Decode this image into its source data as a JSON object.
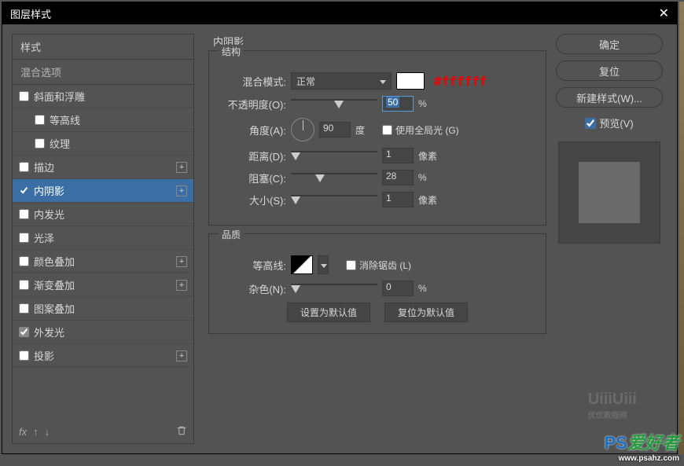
{
  "title": "图层样式",
  "styles_header": "样式",
  "blend_options": "混合选项",
  "style_items": [
    {
      "label": "斜面和浮雕",
      "checked": false,
      "plus": false
    },
    {
      "label": "等高线",
      "checked": false,
      "child": true
    },
    {
      "label": "纹理",
      "checked": false,
      "child": true
    },
    {
      "label": "描边",
      "checked": false,
      "plus": true
    },
    {
      "label": "内阴影",
      "checked": true,
      "plus": true,
      "selected": true
    },
    {
      "label": "内发光",
      "checked": false
    },
    {
      "label": "光泽",
      "checked": false
    },
    {
      "label": "颜色叠加",
      "checked": false,
      "plus": true
    },
    {
      "label": "渐变叠加",
      "checked": false,
      "plus": true
    },
    {
      "label": "图案叠加",
      "checked": false
    },
    {
      "label": "外发光",
      "checked": true
    },
    {
      "label": "投影",
      "checked": false,
      "plus": true
    }
  ],
  "fx_label": "fx",
  "mid": {
    "heading": "内阴影",
    "structure": "结构",
    "blend_mode_label": "混合模式:",
    "blend_mode_value": "正常",
    "hex": "#ffffff",
    "opacity_label": "不透明度(O):",
    "opacity_value": "50",
    "percent": "%",
    "angle_label": "角度(A):",
    "angle_value": "90",
    "degree": "度",
    "global_light": "使用全局光 (G)",
    "distance_label": "距离(D):",
    "distance_value": "1",
    "px": "像素",
    "choke_label": "阻塞(C):",
    "choke_value": "28",
    "size_label": "大小(S):",
    "size_value": "1",
    "quality": "品质",
    "contour_label": "等高线:",
    "antialias": "消除锯齿 (L)",
    "noise_label": "杂色(N):",
    "noise_value": "0",
    "btn_default": "设置为默认值",
    "btn_reset": "复位为默认值"
  },
  "right": {
    "ok": "确定",
    "cancel": "复位",
    "new_style": "新建样式(W)...",
    "preview": "预览(V)"
  },
  "watermark1": "优优教程网",
  "watermark2_a": "PS",
  "watermark2_b": "爱好者",
  "watermark2_url": "www.psahz.com"
}
